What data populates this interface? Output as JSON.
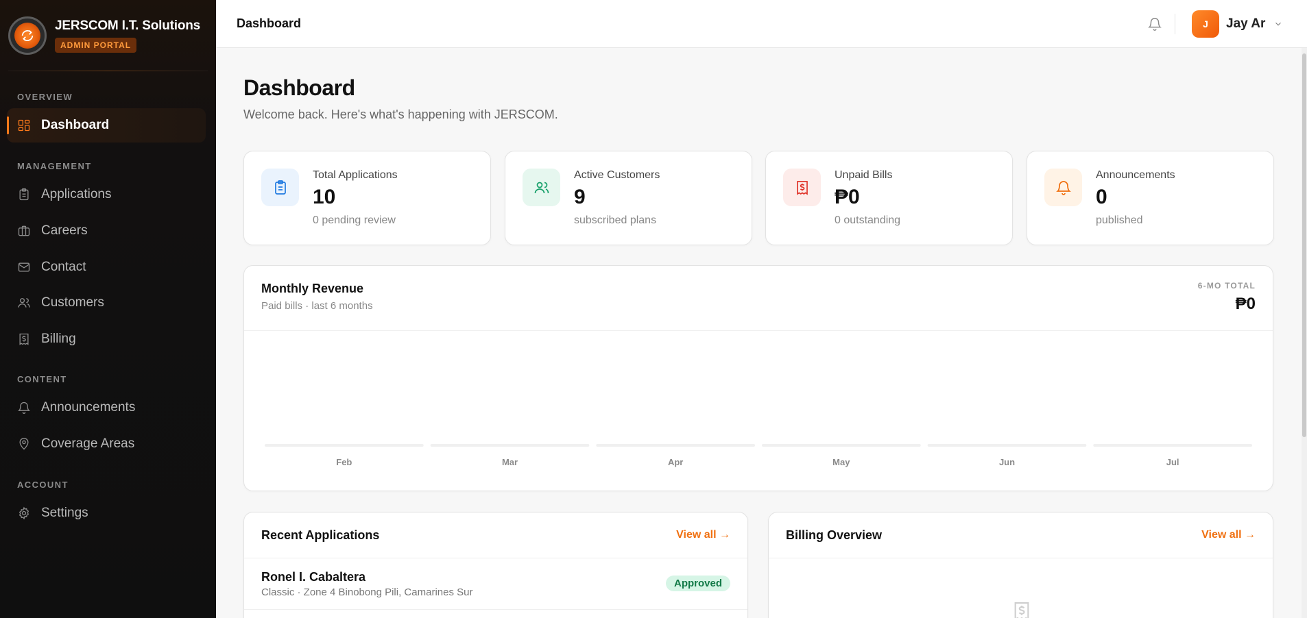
{
  "brand": {
    "name": "JERSCOM I.T. Solutions",
    "badge": "ADMIN PORTAL"
  },
  "sidebar": {
    "sections": [
      {
        "title": "OVERVIEW"
      },
      {
        "title": "MANAGEMENT"
      },
      {
        "title": "CONTENT"
      },
      {
        "title": "ACCOUNT"
      }
    ],
    "items": [
      {
        "label": "Dashboard",
        "icon": "grid-icon",
        "active": true
      },
      {
        "label": "Applications",
        "icon": "clipboard-icon"
      },
      {
        "label": "Careers",
        "icon": "briefcase-icon"
      },
      {
        "label": "Contact",
        "icon": "mail-icon"
      },
      {
        "label": "Customers",
        "icon": "users-icon"
      },
      {
        "label": "Billing",
        "icon": "receipt-icon"
      },
      {
        "label": "Announcements",
        "icon": "bell-icon"
      },
      {
        "label": "Coverage Areas",
        "icon": "map-pin-icon"
      },
      {
        "label": "Settings",
        "icon": "gear-icon"
      }
    ]
  },
  "topbar": {
    "title": "Dashboard",
    "user_initial": "J",
    "user_name": "Jay Ar"
  },
  "main": {
    "title": "Dashboard",
    "subtitle": "Welcome back. Here's what's happening with JERSCOM."
  },
  "stats": [
    {
      "label": "Total Applications",
      "value": "10",
      "sub": "0 pending review",
      "icon": "clipboard-icon",
      "color": "#1f7ae0",
      "bg": "#eaf3fd"
    },
    {
      "label": "Active Customers",
      "value": "9",
      "sub": "subscribed plans",
      "icon": "users-icon",
      "color": "#17a06a",
      "bg": "#e6f7ef"
    },
    {
      "label": "Unpaid Bills",
      "value": "₱0",
      "sub": "0 outstanding",
      "icon": "receipt-icon",
      "color": "#e0352b",
      "bg": "#fdecea"
    },
    {
      "label": "Announcements",
      "value": "0",
      "sub": "published",
      "icon": "bell-icon",
      "color": "#f07010",
      "bg": "#fff3e6"
    }
  ],
  "revenue": {
    "title": "Monthly Revenue",
    "subtitle": "Paid bills · last 6 months",
    "total_label": "6-MO TOTAL",
    "total_value": "₱0"
  },
  "chart_data": {
    "type": "bar",
    "categories": [
      "Feb",
      "Mar",
      "Apr",
      "May",
      "Jun",
      "Jul"
    ],
    "values": [
      0,
      0,
      0,
      0,
      0,
      0
    ],
    "title": "Monthly Revenue",
    "subtitle": "Paid bills · last 6 months",
    "xlabel": "",
    "ylabel": "",
    "grid": false,
    "accent": "#f07010"
  },
  "recent": {
    "title": "Recent Applications",
    "view_all": "View all →",
    "rows": [
      {
        "name": "Ronel I. Cabaltera",
        "meta": "Classic · Zone 4 Binobong Pili, Camarines Sur",
        "status": "Approved"
      }
    ]
  },
  "billing": {
    "title": "Billing Overview",
    "view_all": "View all →"
  }
}
